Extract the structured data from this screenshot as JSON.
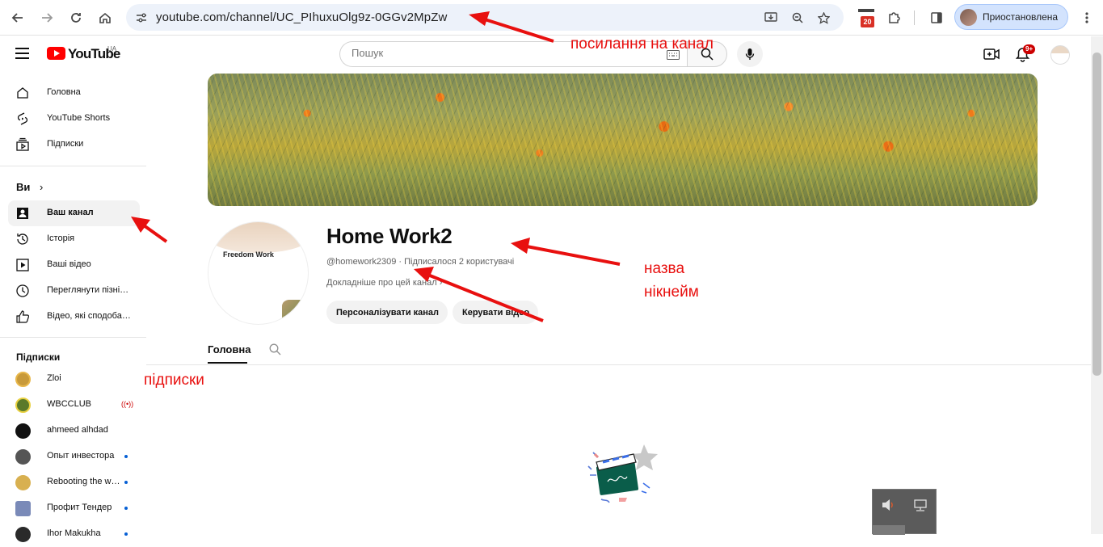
{
  "browser": {
    "url": "youtube.com/channel/UC_PIhuxuOlg9z-0GGv2MpZw",
    "profile_label": "Приостановлена",
    "calendar_badge": "20"
  },
  "header": {
    "logo_text": "YouTube",
    "logo_country": "UA",
    "search_placeholder": "Пошук",
    "notifications_badge": "9+"
  },
  "sidebar": {
    "main": [
      {
        "label": "Головна",
        "icon": "home-icon"
      },
      {
        "label": "YouTube Shorts",
        "icon": "shorts-icon"
      },
      {
        "label": "Підписки",
        "icon": "subscriptions-icon"
      }
    ],
    "you_heading": "Ви",
    "you": [
      {
        "label": "Ваш канал",
        "icon": "your-channel-icon"
      },
      {
        "label": "Історія",
        "icon": "history-icon"
      },
      {
        "label": "Ваші відео",
        "icon": "your-videos-icon"
      },
      {
        "label": "Переглянути пізні…",
        "icon": "watch-later-icon"
      },
      {
        "label": "Відео, які сподоба…",
        "icon": "liked-icon"
      }
    ],
    "subs_heading": "Підписки",
    "subscriptions": [
      {
        "label": "Zloi",
        "color": "#c89a3a"
      },
      {
        "label": "WBCCLUB",
        "color": "#5a7a2a",
        "live": true
      },
      {
        "label": "ahmeed alhdad",
        "color": "#111111"
      },
      {
        "label": "Опыт инвестора",
        "color": "#555555",
        "dot": true
      },
      {
        "label": "Rebooting the w…",
        "color": "#d8b050",
        "dot": true
      },
      {
        "label": "Профит Тендер",
        "color": "#7a8ab8",
        "dot": true
      },
      {
        "label": "Ihor Makukha",
        "color": "#2a2a2a",
        "dot": true
      }
    ]
  },
  "channel": {
    "avatar_text": "Freedom Work",
    "title": "Home Work2",
    "handle_meta": "@homework2309 · Підписалося 2 користувачі",
    "about": "Докладніше про цей канал",
    "customize_button": "Персоналізувати канал",
    "manage_button": "Керувати відео",
    "tab_home": "Головна"
  },
  "annotations": {
    "link": "посилання на канал",
    "name": "назва",
    "nickname": "нікнейм",
    "subscriptions": "підписки"
  }
}
